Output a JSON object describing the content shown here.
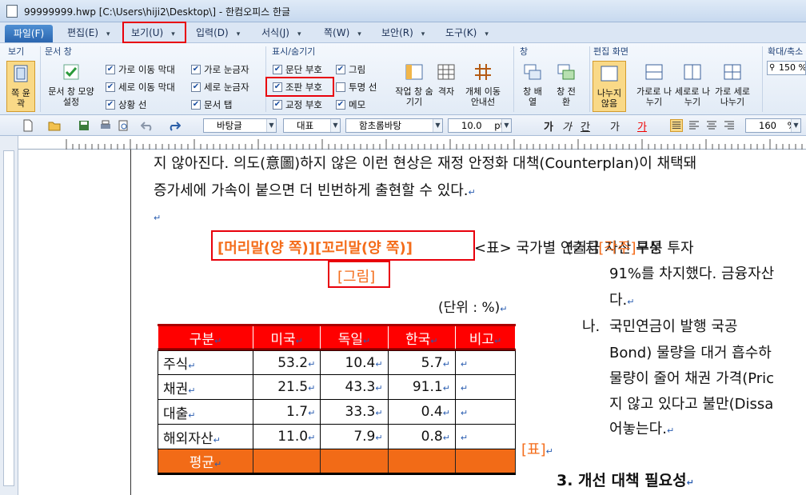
{
  "window": {
    "title": "99999999.hwp [C:\\Users\\hiji2\\Desktop\\] - 한컴오피스 한글"
  },
  "menu": {
    "file": "파일(F)",
    "items": [
      "편집(E)",
      "보기(U)",
      "입력(D)",
      "서식(J)",
      "쪽(W)",
      "보안(R)",
      "도구(K)"
    ]
  },
  "ribbon": {
    "groups": {
      "view": "보기",
      "doc_window": "문서 창",
      "show_hide": "표시/숨기기",
      "window": "창",
      "edit_screen": "편집 화면",
      "zoom": "확대/축소"
    },
    "fit_page": "쪽 윤곽",
    "doc_window_style": "문서 창 모양 설정",
    "checks_doc": [
      "가로 이동 막대",
      "세로 이동 막대",
      "상황 선",
      "가로 눈금자",
      "세로 눈금자",
      "문서 탭"
    ],
    "checks_show": [
      "문단 부호",
      "그림",
      "조판 부호",
      "투명 선",
      "교정 부호",
      "메모"
    ],
    "work_window": "작업 창 숨기기",
    "grid": "격자",
    "obj_move_guide": "개체 이동 안내선",
    "window_arrange": "창 배열",
    "window_switch": "창 전환",
    "split_none": "나누지 않음",
    "split_h": "가로로 나누기",
    "split_v": "세로로 나누기",
    "split_hv": "가로 세로 나누기",
    "zoom_value": "150 %"
  },
  "toolbar": {
    "style": "바탕글",
    "lang": "대표",
    "font": "함초롬바탕",
    "size": "10.0",
    "unit": "pt",
    "zoom": "160",
    "zoom_unit": "%"
  },
  "document": {
    "line1": "지 않아진다. 의도(意圖)하지 않은 이런 현상은 재정 안정화 대책(Counterplan)이 채택돼",
    "line2": "증가세에 가속이 붙으면 더 빈번하게 출현할 수 있다.",
    "header_footer": "[머리말(양 쪽)][꼬리말(양 쪽)]",
    "table_caption": "<표> 국가별 연기금 자산 구성",
    "overlap_text": "(출처",
    "overlap_orange": "[각주]",
    "overlap_tail": "부문 투자",
    "figure": "[그림]",
    "unit": "(단위 : %)",
    "right_1": "91%를 차지했다. 금융자산",
    "right_2": "다.",
    "right_3_label": "나.",
    "right_3": "국민연금이    발행    국공",
    "right_4": "Bond) 물량을 대거 흡수하",
    "right_5": "물량이 줄어 채권 가격(Pric",
    "right_6": "지 않고 있다고 불만(Dissa",
    "right_7": "어놓는다.",
    "table_tag": "[표]",
    "section_heading": "3. 개선 대책 필요성"
  },
  "table": {
    "headers": [
      "구분",
      "미국",
      "독일",
      "한국",
      "비고"
    ],
    "rows": [
      [
        "주식",
        "53.2",
        "10.4",
        "5.7",
        ""
      ],
      [
        "채권",
        "21.5",
        "43.3",
        "91.1",
        ""
      ],
      [
        "대출",
        "1.7",
        "33.3",
        "0.4",
        ""
      ],
      [
        "해외자산",
        "11.0",
        "7.9",
        "0.8",
        ""
      ]
    ],
    "avg_label": "평균"
  },
  "colors": {
    "accent_red": "#e8000b",
    "table_header": "#ff0000",
    "avg_row": "#f26b17",
    "orange_text": "#f46c1a"
  }
}
